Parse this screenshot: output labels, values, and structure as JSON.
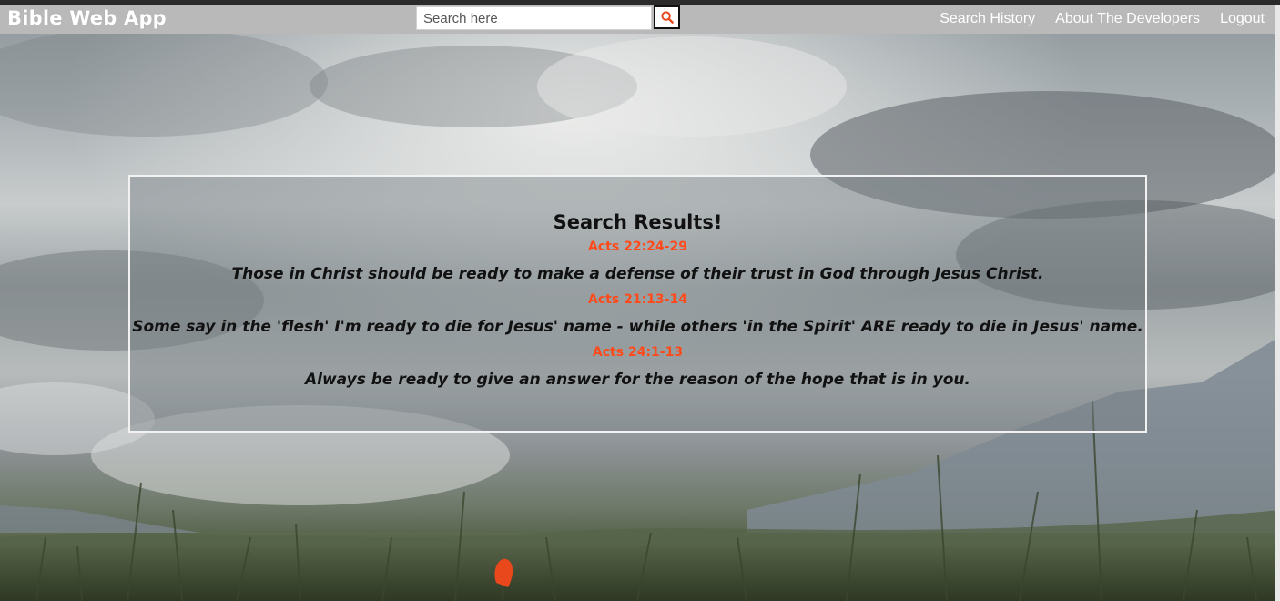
{
  "app": {
    "title": "Bible Web App"
  },
  "search": {
    "placeholder": "Search here",
    "button_icon": "search-icon",
    "accent_color": "#ff4a1c"
  },
  "nav": {
    "links": [
      {
        "label": "Search History"
      },
      {
        "label": "About The Developers"
      },
      {
        "label": "Logout"
      }
    ]
  },
  "results": {
    "title": "Search Results!",
    "items": [
      {
        "reference": "Acts 22:24-29",
        "text": "Those in Christ should be ready to make a defense of their trust in God through Jesus Christ."
      },
      {
        "reference": "Acts 21:13-14",
        "text": "Some say in the 'flesh' I'm ready to die for Jesus' name - while others 'in the Spirit' ARE ready to die in Jesus' name."
      },
      {
        "reference": "Acts 24:1-13",
        "text": "Always be ready to give an answer for the reason of the hope that is in you."
      }
    ]
  },
  "colors": {
    "navbar": "#b9b9b9",
    "reference": "#ff4a1c",
    "verse_text": "#111111"
  }
}
